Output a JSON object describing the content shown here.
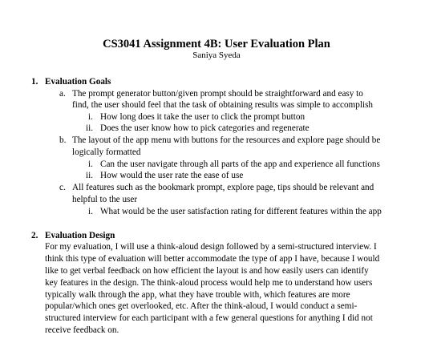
{
  "document": {
    "title": "CS3041 Assignment 4B: User Evaluation Plan",
    "author": "Saniya Syeda"
  },
  "section1": {
    "number": "1.",
    "heading": "Evaluation Goals",
    "goal_a": {
      "marker": "a.",
      "line1": "The prompt generator button/given prompt should be straightforward and easy to",
      "line2": "find, the user should feel that the task of obtaining results was simple to accomplish",
      "sub_i": {
        "marker": "i.",
        "text": "How long does it take the user to click the prompt button"
      },
      "sub_ii": {
        "marker": "ii.",
        "text": "Does the user know how to pick categories and regenerate"
      }
    },
    "goal_b": {
      "marker": "b.",
      "line1": "The layout of the app menu with buttons for the resources and explore page should be",
      "line2": "logically formatted",
      "sub_i": {
        "marker": "i.",
        "text": "Can the user navigate through all parts of the app and experience all functions"
      },
      "sub_ii": {
        "marker": "ii.",
        "text": "How would the user rate the ease of use"
      }
    },
    "goal_c": {
      "marker": "c.",
      "line1": "All features such as the bookmark prompt, explore page, tips should be relevant and",
      "line2": "helpful to the user",
      "sub_i": {
        "marker": "i.",
        "text": "What would be the user satisfaction rating for different features within the app"
      }
    }
  },
  "section2": {
    "number": "2.",
    "heading": "Evaluation Design",
    "lines": [
      "For my evaluation, I will use a think-aloud design followed by a semi-structured interview. I",
      "think this type of evaluation will better accommodate the type of app I have, because I would",
      "like to get verbal feedback on how efficient the layout is and how easily users can identify",
      "key features in the design. The think-aloud process would help me to understand how users",
      "typically walk through the app, what they have trouble with, which features are more",
      "popular/which ones get overlooked, etc. After the think-aloud, I would conduct a semi-",
      "structured interview for each participant with a few general questions for anything I did not",
      "receive feedback on."
    ]
  }
}
